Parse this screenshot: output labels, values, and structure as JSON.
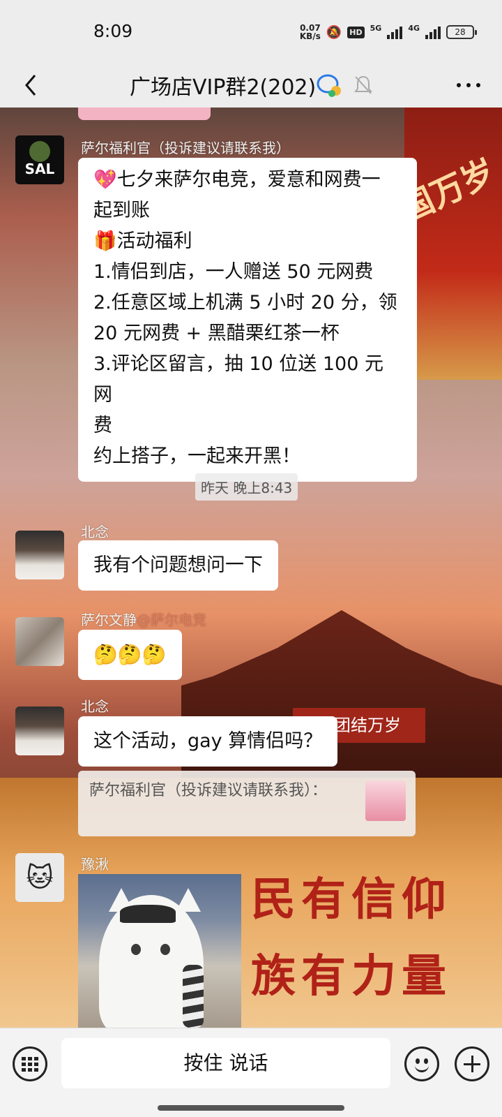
{
  "status_bar": {
    "time": "8:09",
    "net_speed_value": "0.07",
    "net_speed_unit": "KB/s",
    "hd_badge": "HD",
    "signal_1": "5G",
    "signal_2": "4G",
    "battery": "28"
  },
  "header": {
    "title": "广场店VIP群2(202)"
  },
  "messages": [
    {
      "sender": "萨尔福利官（投诉建议请联系我）",
      "lines": [
        "💖七夕来萨尔电竞，爱意和网费一",
        "起到账",
        "🎁活动福利",
        "1.情侣到店，一人赠送 50 元网费",
        "2.任意区域上机满 5 小时 20 分，领",
        "20 元网费 + 黑醋栗红茶一杯",
        "3.评论区留言，抽 10 位送 100 元网",
        "费",
        "约上搭子，一起来开黑！"
      ]
    },
    {
      "sender": "北念",
      "text": "我有个问题想问一下"
    },
    {
      "sender": "萨尔文静",
      "sender_tag": "@萨尔电竞",
      "text": "🤔🤔🤔"
    },
    {
      "sender": "北念",
      "text": "这个活动，gay 算情侣吗？"
    },
    {
      "sender": "豫湫"
    }
  ],
  "time_separator": "昨天 晚上8:43",
  "reply_card": {
    "text": "萨尔福利官（投诉建议请联系我）："
  },
  "avatars": {
    "sal_logo_text": "SAL",
    "kitty": "🐱"
  },
  "background": {
    "gate_text": "国万岁",
    "banner_text": "大团结万岁",
    "slogan_line_1": "民有信仰",
    "slogan_line_2": "族有力量"
  },
  "input_bar": {
    "voice_label": "按住 说话"
  },
  "icons": [
    "back-icon",
    "group-icon",
    "mute-icon",
    "more-icon",
    "keyboard-icon",
    "emoji-icon",
    "plus-icon"
  ]
}
